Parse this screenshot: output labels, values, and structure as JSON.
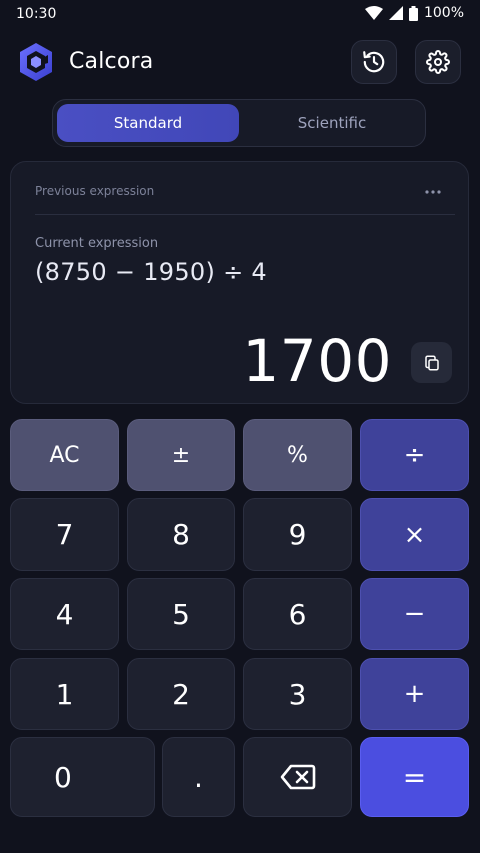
{
  "status": {
    "time": "10:30",
    "battery": "100%"
  },
  "app": {
    "title": "Calcora"
  },
  "modes": {
    "standard": "Standard",
    "scientific": "Scientific"
  },
  "display": {
    "previous_label": "Previous expression",
    "current_label": "Current expression",
    "expression": "(8750 − 1950) ÷ 4",
    "result": "1700"
  },
  "keys": {
    "ac": "AC",
    "sign": "±",
    "percent": "%",
    "divide": "÷",
    "seven": "7",
    "eight": "8",
    "nine": "9",
    "multiply": "×",
    "four": "4",
    "five": "5",
    "six": "6",
    "minus": "−",
    "one": "1",
    "two": "2",
    "three": "3",
    "plus": "+",
    "zero": "0",
    "dot": ".",
    "equals": "="
  },
  "colors": {
    "accent": "#4b4ee0",
    "operator": "#3f429a",
    "function": "#4f5170",
    "background": "#10121d"
  }
}
